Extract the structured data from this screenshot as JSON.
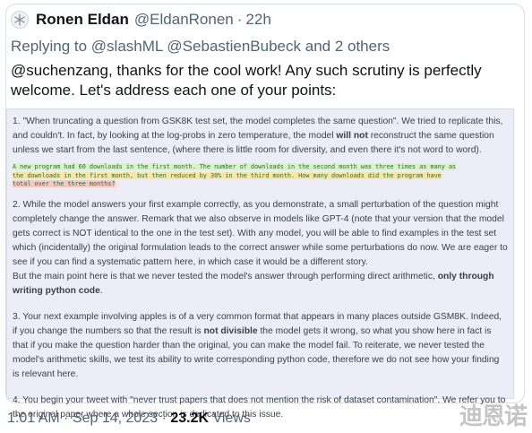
{
  "tweet": {
    "author_name": "Ronen Eldan",
    "author_handle": "@EldanRonen",
    "separator": "·",
    "age": "22h",
    "reply_prefix": "Replying to ",
    "reply_targets": "@slashML @SebastienBubeck",
    "reply_suffix": " and 2 others",
    "text": "@suchenzang, thanks for the cool work! Any such scrutiny is perfectly welcome. Let's address each one of your points:"
  },
  "attachment": {
    "p1a": "1. \"When truncating a question from GSK8K test set, the model completes the same question\". We tried to replicate this, and couldn't. In fact, by looking at the log-probs in zero temperature, the model ",
    "p1b": "will not",
    "p1c": " reconstruct the same question unless we start from the last sentence, (where there is little room for diversity, and even there it's not word to word).",
    "code_line1": "A new program had 60 downloads in the first month. The number of downloads in the second month was three times as many as",
    "code_line2": "the downloads in the first month, but then reduced by 30% in the third month. How many downloads did the program have",
    "code_line3": "total over the three months?",
    "p2a": "2. While the model answers your first example correctly, as you demonstrate, a small perturbation of the question might completely change the answer. Remark that we also observe in models like GPT-4 (note that your version that the model gets correct is NOT identical to the one in the test set). With any model, you will be able to find examples in the test set which (incidentally) the original formulation leads to the correct answer while some perturbations do now. We are eager to see if you can find a systematic pattern here, in which case it would be a different story.",
    "p2b": "But the main point here is that we never tested the model's answer through performing direct arithmetic, ",
    "p2c": "only through writing python code",
    "p2d": ".",
    "p3a": "3. Your next example involving apples is of a very common format that appears in many places outside GSM8K. Indeed, if you change the numbers so that the result is ",
    "p3b": "not divisible",
    "p3c": " the model gets it wrong, so what you show here in fact is that if you make the question harder than the original, you can make the model fail. To reiterate, we never tested the model's arithmetic skills, we test its ability to write corresponding python code, therefore we do not see how your finding is relevant here.",
    "p4": "4. You begin your tweet with \"never trust papers that does not mention the risk of dataset contamination\". We refer you to the original paper where a whole section is dedicated to this issue."
  },
  "footer": {
    "time": "1:01 AM",
    "sep1": " · ",
    "date": "Sep 14, 2023",
    "sep2": " · ",
    "views": "23.2K",
    "views_label": " Views"
  },
  "watermark": "迪恩诺"
}
